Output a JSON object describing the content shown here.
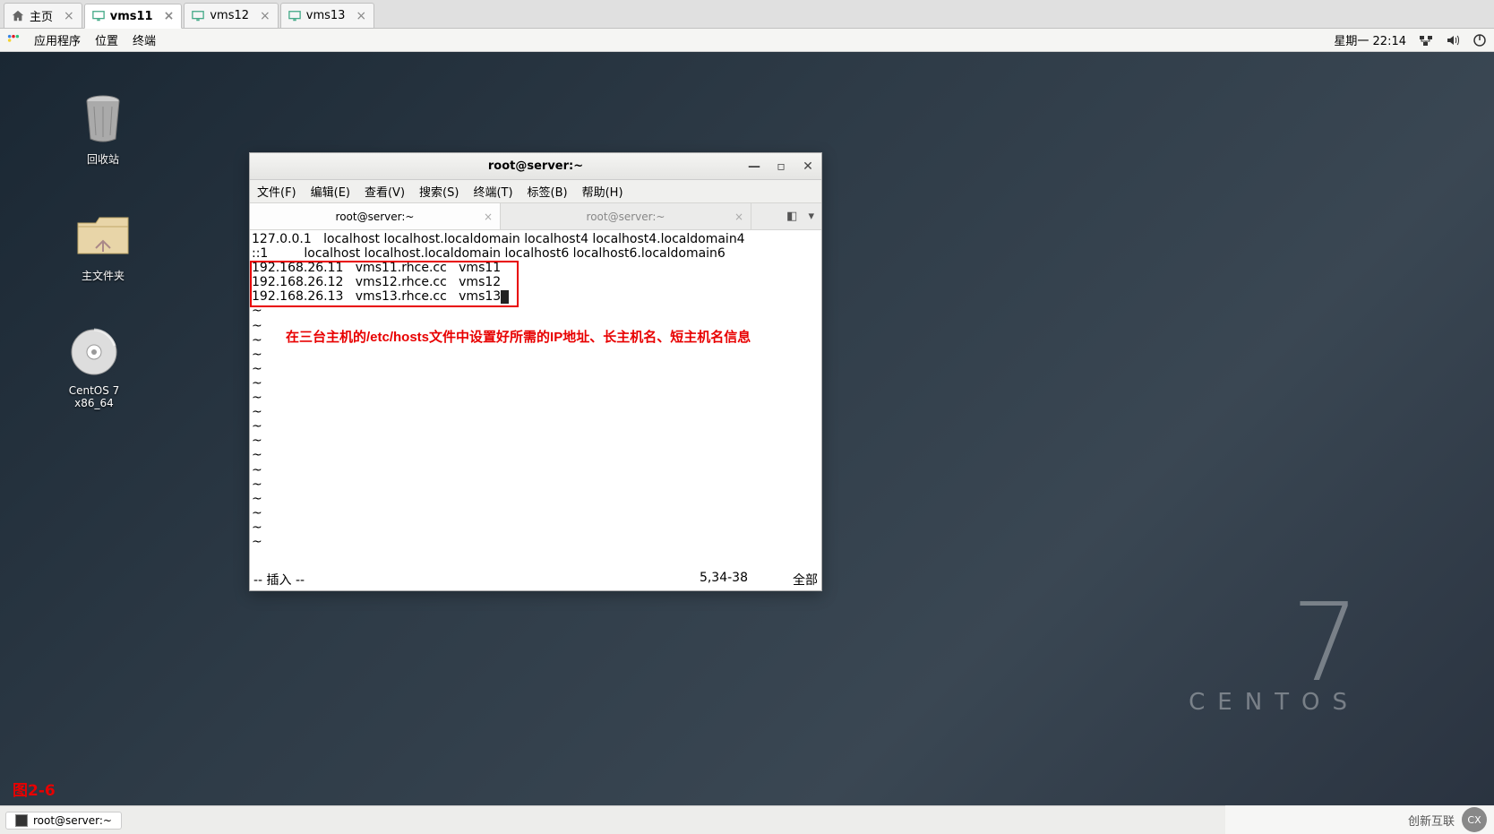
{
  "vm_tabs": [
    {
      "label": "主页",
      "active": false,
      "type": "home"
    },
    {
      "label": "vms11",
      "active": true,
      "type": "vm"
    },
    {
      "label": "vms12",
      "active": false,
      "type": "vm"
    },
    {
      "label": "vms13",
      "active": false,
      "type": "vm"
    }
  ],
  "gnome": {
    "apps": "应用程序",
    "places": "位置",
    "terminal": "终端",
    "datetime": "星期一 22:14"
  },
  "desktop_icons": {
    "trash": "回收站",
    "home": "主文件夹",
    "cd": "CentOS 7 x86_64"
  },
  "centos": {
    "seven": "7",
    "word": "CENTOS"
  },
  "terminal": {
    "title": "root@server:~",
    "menu": [
      "文件(F)",
      "编辑(E)",
      "查看(V)",
      "搜索(S)",
      "终端(T)",
      "标签(B)",
      "帮助(H)"
    ],
    "tabs": [
      {
        "label": "root@server:~",
        "active": true
      },
      {
        "label": "root@server:~",
        "active": false
      }
    ],
    "lines": [
      "127.0.0.1   localhost localhost.localdomain localhost4 localhost4.localdomain4",
      "::1         localhost localhost.localdomain localhost6 localhost6.localdomain6",
      "192.168.26.11   vms11.rhce.cc   vms11",
      "192.168.26.12   vms12.rhce.cc   vms12",
      "192.168.26.13   vms13.rhce.cc   vms13"
    ],
    "annotation": "在三台主机的/etc/hosts文件中设置好所需的IP地址、长主机名、短主机名信息",
    "status_mode": "-- 插入 --",
    "status_pos": "5,34-38",
    "status_scroll": "全部"
  },
  "figure_label": "图2-6",
  "taskbar_item": "root@server:~",
  "watermark": "创新互联"
}
